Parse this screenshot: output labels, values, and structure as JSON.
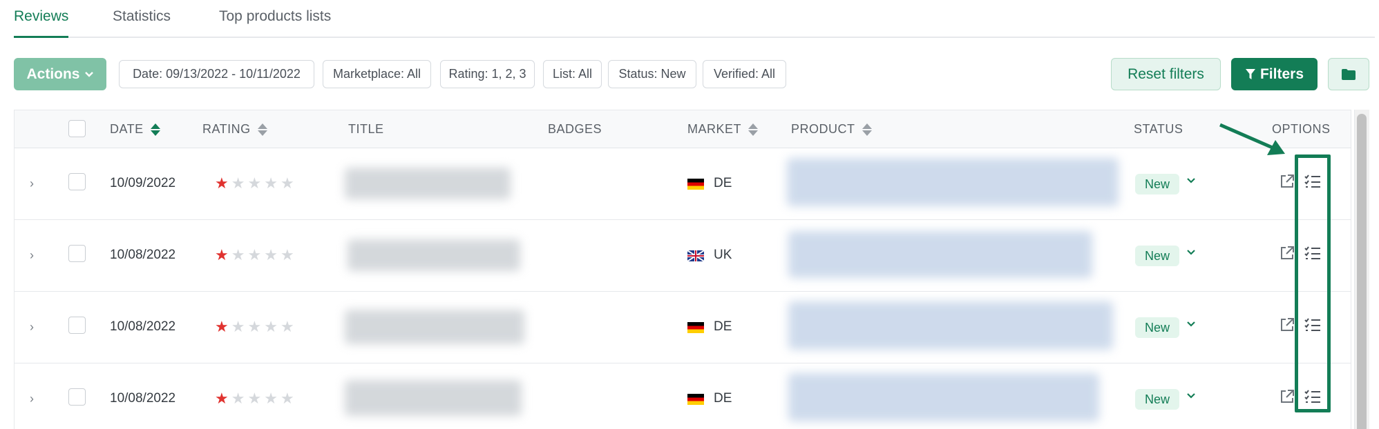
{
  "tabs": [
    {
      "label": "Reviews",
      "active": true
    },
    {
      "label": "Statistics",
      "active": false
    },
    {
      "label": "Top products lists",
      "active": false
    }
  ],
  "toolbar": {
    "actions_label": "Actions",
    "filter_chips": [
      "Date: 09/13/2022 - 10/11/2022",
      "Marketplace: All",
      "Rating: 1, 2, 3",
      "List: All",
      "Status: New",
      "Verified: All"
    ],
    "reset_label": "Reset filters",
    "filters_label": "Filters",
    "folder_icon": "folder-icon",
    "filter_icon": "funnel-icon"
  },
  "table": {
    "columns": {
      "date": "DATE",
      "rating": "RATING",
      "title": "TITLE",
      "badges": "BADGES",
      "market": "MARKET",
      "product": "PRODUCT",
      "status": "STATUS",
      "options": "OPTIONS"
    },
    "rows": [
      {
        "date": "10/09/2022",
        "rating": 1,
        "market": "DE",
        "flag": "de",
        "status": "New"
      },
      {
        "date": "10/08/2022",
        "rating": 1,
        "market": "UK",
        "flag": "uk",
        "status": "New"
      },
      {
        "date": "10/08/2022",
        "rating": 1,
        "market": "DE",
        "flag": "de",
        "status": "New"
      },
      {
        "date": "10/08/2022",
        "rating": 1,
        "market": "DE",
        "flag": "de",
        "status": "New"
      }
    ]
  },
  "colors": {
    "brand": "#137d56",
    "star_filled": "#e0322f",
    "star_empty": "#d5d8dc",
    "annotation": "#137d56"
  }
}
